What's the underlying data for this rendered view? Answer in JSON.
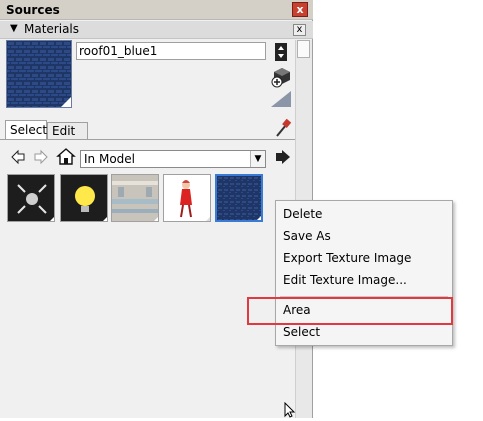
{
  "window": {
    "title": "Sources",
    "close_glyph": "x"
  },
  "section": {
    "label": "Materials",
    "close_glyph": "x"
  },
  "material": {
    "name": "roof01_blue1"
  },
  "tabs": [
    {
      "label": "Select"
    },
    {
      "label": "Edit"
    }
  ],
  "collection": {
    "value": "In Model",
    "arrow": "▼"
  },
  "thumbnails": [
    {
      "name": "light-arrows-material"
    },
    {
      "name": "yellow-bulb-material"
    },
    {
      "name": "textured-stone-material"
    },
    {
      "name": "figure-material"
    },
    {
      "name": "roof-blue-material",
      "selected": true
    }
  ],
  "context_menu": {
    "items": [
      "Delete",
      "Save As",
      "Export Texture Image",
      "Edit Texture Image...",
      "Area",
      "Select"
    ],
    "highlighted": "Area"
  },
  "colors": {
    "accent": "#3a7bd5",
    "highlight_box": "#e0393f",
    "roof_tile": "#1f3566"
  }
}
